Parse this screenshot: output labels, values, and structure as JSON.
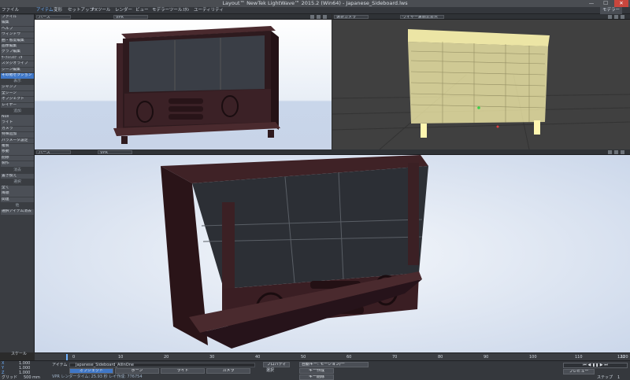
{
  "window": {
    "title": "Layout™ NewTek LightWave™ 2015.2 (Win64) - Japanese_Sideboard.lws",
    "minimize": "—",
    "maximize": "☐",
    "close": "✕"
  },
  "menu": {
    "items": [
      "ファイル",
      "アイテム",
      "変形",
      "セットアップ",
      "FXツール",
      "レンダー",
      "ビュー",
      "モデラーツール",
      "ｽﾀｼ",
      "ユーティリティ"
    ],
    "right_button": "モデラー"
  },
  "sidebar": {
    "top_items": [
      "ファイル",
      "編集",
      "ヘルプ",
      "ウィンドウ",
      "曲・態度編集",
      "画像編集",
      "グラフ編集",
      "ｻｰﾌｪｲｽｴﾃﾞｨﾀ",
      "スタジオライブ",
      "シーン編集",
      "その他セクション"
    ],
    "section_view": "表示",
    "view_items": [
      "シャンフ",
      "全シーン",
      "オブジェクト",
      "レイヤー"
    ],
    "section_add": "追加",
    "add_items": [
      "Null",
      "ライト",
      "カメラ",
      "特殊追加",
      "パラメータ設定",
      "複製",
      "移動",
      "削除",
      "製作"
    ],
    "section_delete": "消去",
    "delete_items": [
      "置き換え"
    ],
    "section_select": "選択",
    "select_items": [
      "全て",
      "降順",
      "関連"
    ],
    "section_misc": "他",
    "misc_items": [
      "選択アイテム消去"
    ]
  },
  "viewports": {
    "top_left": {
      "mode": "パース",
      "render": "VPR"
    },
    "top_right": {
      "mode": "選択カメラ",
      "render": "ワイヤー裏面非表示"
    },
    "bottom": {
      "mode": "パース",
      "render": "VPR"
    }
  },
  "timeline": {
    "ticks": [
      "0",
      "10",
      "20",
      "30",
      "40",
      "50",
      "60",
      "70",
      "80",
      "90",
      "100",
      "110",
      "120"
    ],
    "end": "120",
    "current": "0"
  },
  "bottom": {
    "scale_label": "スケール",
    "x": {
      "axis": "X",
      "value": "1.000"
    },
    "y": {
      "axis": "Y",
      "value": "1.000"
    },
    "z": {
      "axis": "Z",
      "value": "1.000"
    },
    "grid_label": "グリッド",
    "grid_value": "500 mm",
    "item_label": "アイテム",
    "item_value": "Japanese_Sideboard_AllInOne",
    "properties": "プロパティ",
    "tabs": [
      "オブジェクト",
      "ボーン",
      "ライト",
      "カメラ"
    ],
    "select_label": "選択",
    "auto_key": "自動キー: モーション/ー",
    "create_key": "キー作成",
    "delete_key": "キー削除",
    "vpr_status": "VPR レンダータイム: 25.93 秒  レイ作成: 776754",
    "preview": "プレビュー",
    "step_label": "ステップ",
    "step_value": "1"
  },
  "colors": {
    "accent": "#3f77c7",
    "wire": "#fff7b0",
    "wood": "#3a1e22",
    "sky": "#cfdcee"
  }
}
